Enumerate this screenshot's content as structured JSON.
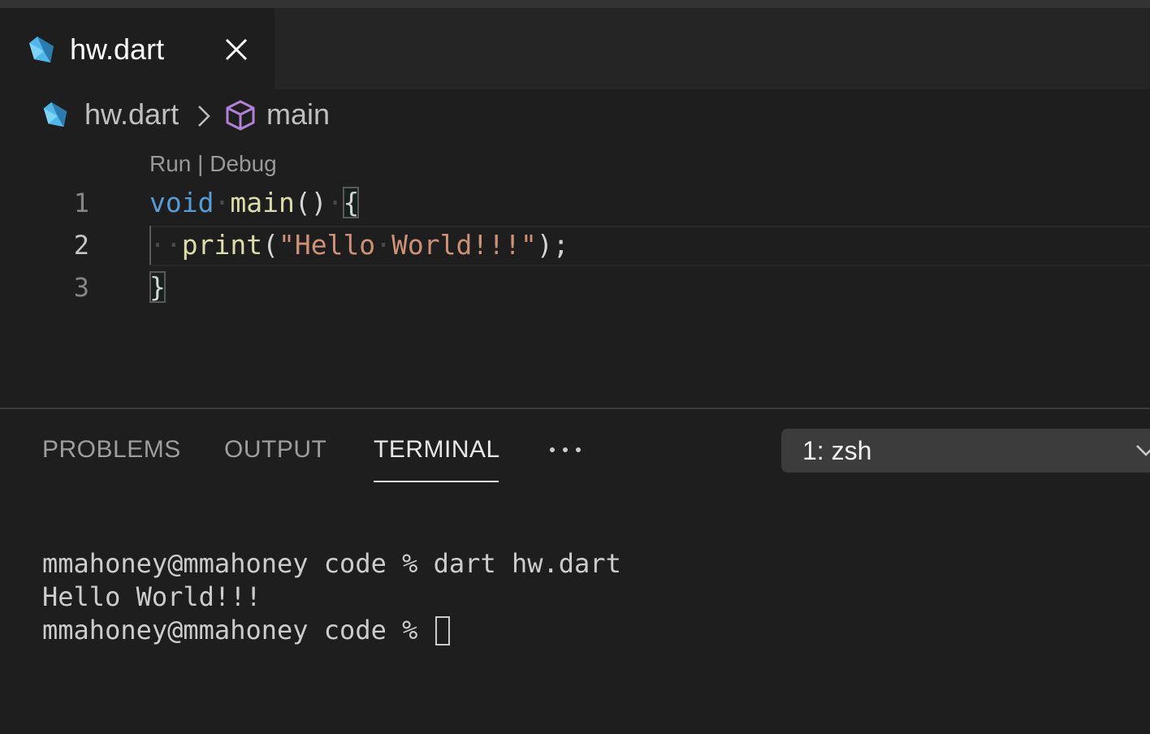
{
  "editor_tab": {
    "label": "hw.dart",
    "icon": "dart-icon"
  },
  "breadcrumb": {
    "file": "hw.dart",
    "symbol": "main"
  },
  "codelens": {
    "run": "Run",
    "separator": " | ",
    "debug": "Debug"
  },
  "lines": {
    "l1": {
      "num": "1",
      "kw": "void",
      "fn": "main",
      "rest": "() ",
      "brace": "{"
    },
    "l2": {
      "num": "2",
      "fn": "print",
      "open": "(",
      "str": "\"Hello World!!!\"",
      "close": ");"
    },
    "l3": {
      "num": "3",
      "brace": "}"
    }
  },
  "panel": {
    "tabs": {
      "problems": "PROBLEMS",
      "output": "OUTPUT",
      "terminal": "TERMINAL"
    },
    "active_tab": "TERMINAL",
    "terminal_select": "1: zsh"
  },
  "terminal": {
    "line1": "mmahoney@mmahoney code % dart hw.dart",
    "line2": "Hello World!!!",
    "line3": "mmahoney@mmahoney code % "
  },
  "colors": {
    "background": "#1e1e1e",
    "keyword": "#569cd6",
    "function": "#dcdcaa",
    "string": "#ce9178",
    "symbol_icon": "#b180d7",
    "dart_icon": "#40c4ff"
  }
}
